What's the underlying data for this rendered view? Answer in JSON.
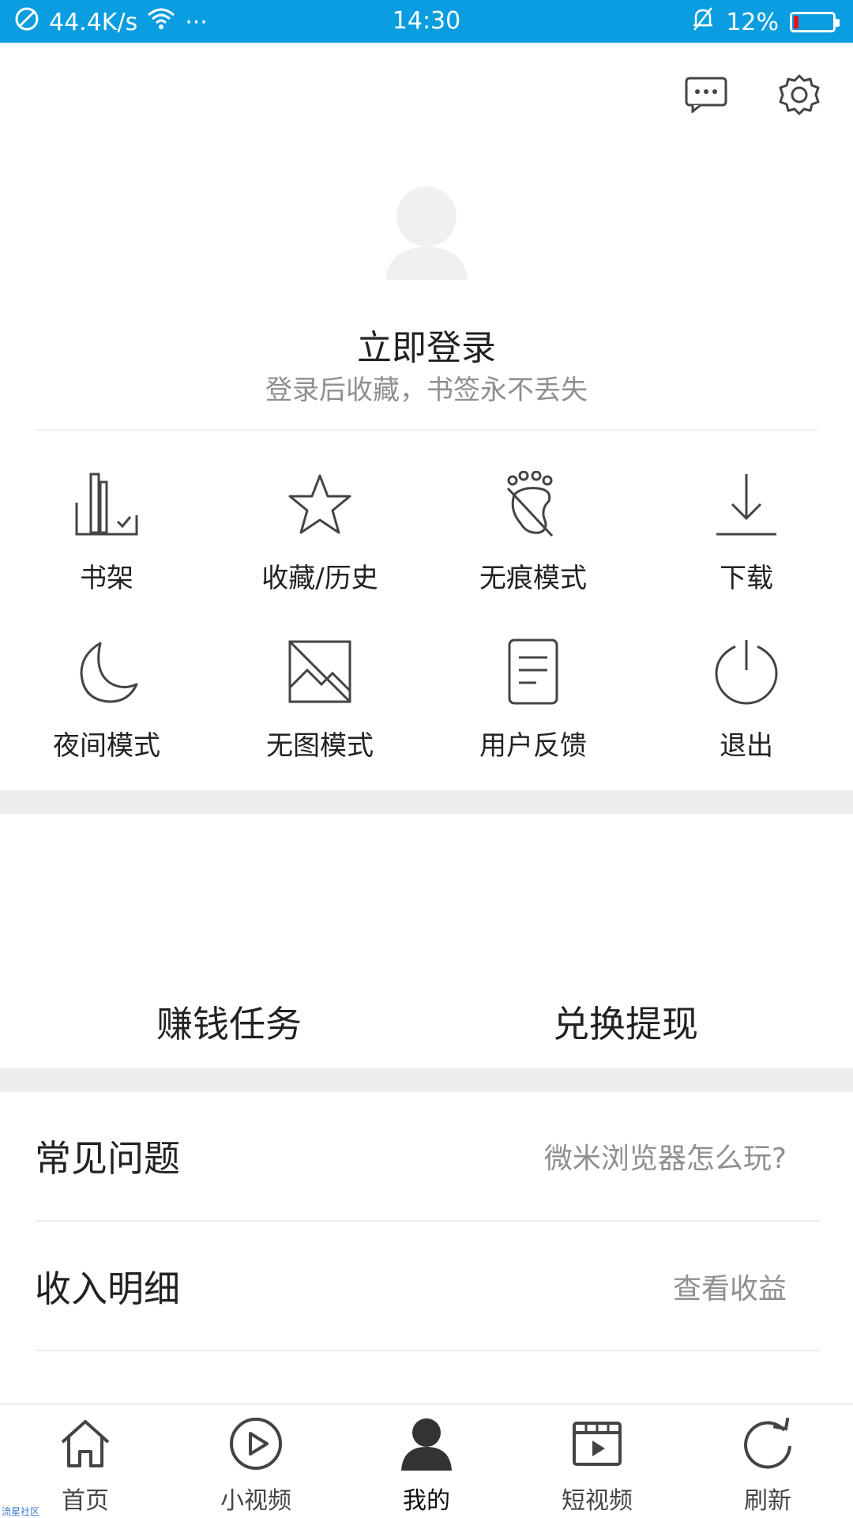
{
  "statusbar": {
    "speed": "44.4K/s",
    "more": "···",
    "time": "14:30",
    "battery": "12%",
    "battery_level": 0.12,
    "battery_color": "#e0151b",
    "bg_color": "#0a9de0"
  },
  "header": {
    "message_icon": "message-icon",
    "settings_icon": "gear-icon"
  },
  "profile": {
    "title": "立即登录",
    "subtitle": "登录后收藏，书签永不丢失"
  },
  "grid": {
    "items": [
      {
        "label": "书架",
        "icon": "bookshelf-icon"
      },
      {
        "label": "收藏/历史",
        "icon": "star-icon"
      },
      {
        "label": "无痕模式",
        "icon": "footprint-off-icon"
      },
      {
        "label": "下载",
        "icon": "download-icon"
      },
      {
        "label": "夜间模式",
        "icon": "moon-icon"
      },
      {
        "label": "无图模式",
        "icon": "no-image-icon"
      },
      {
        "label": "用户反馈",
        "icon": "document-icon"
      },
      {
        "label": "退出",
        "icon": "power-icon"
      }
    ]
  },
  "tasks": {
    "earn": "赚钱任务",
    "redeem": "兑换提现"
  },
  "list": [
    {
      "label": "常见问题",
      "value": "微米浏览器怎么玩?"
    },
    {
      "label": "收入明细",
      "value": "查看收益"
    }
  ],
  "tabbar": {
    "items": [
      {
        "label": "首页",
        "icon": "home-icon"
      },
      {
        "label": "小视频",
        "icon": "play-circle-icon"
      },
      {
        "label": "我的",
        "icon": "user-icon",
        "active": true
      },
      {
        "label": "短视频",
        "icon": "video-clapper-icon"
      },
      {
        "label": "刷新",
        "icon": "refresh-icon"
      }
    ]
  },
  "watermark": "流星社区"
}
